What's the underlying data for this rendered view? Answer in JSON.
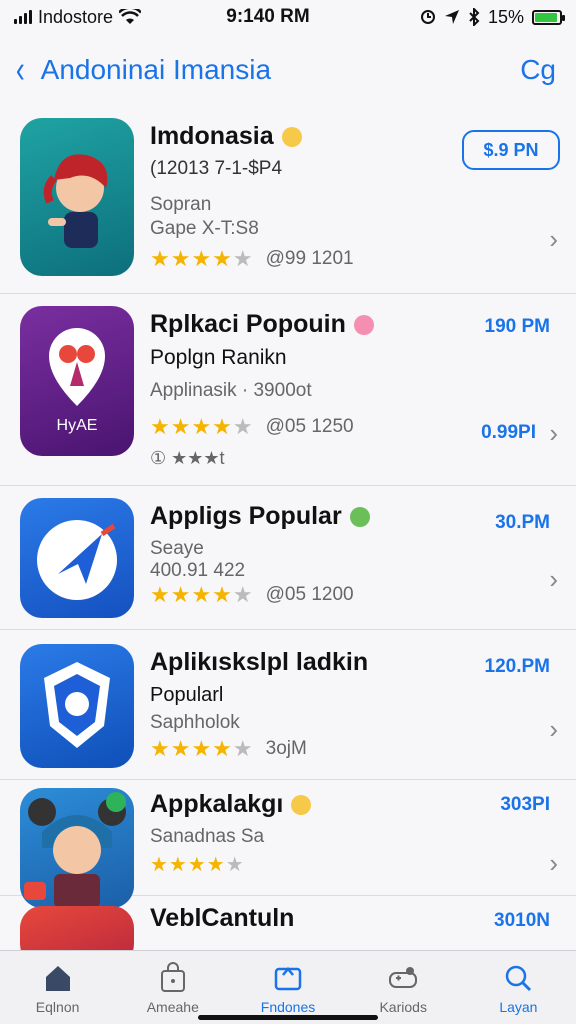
{
  "status_bar": {
    "carrier": "Indostore",
    "time": "9:140 RM",
    "battery_text": "15%"
  },
  "nav": {
    "back_label": "‹",
    "title": "Andoninai Imansia",
    "action": "Cg"
  },
  "apps": [
    {
      "name": "Imdonasia",
      "lines": [
        "(12013 7-1-$P4",
        "Sopran",
        "Gape X-T:S8"
      ],
      "stars": 4,
      "rating_text": "@99 1201",
      "price": "$.9 PN",
      "price_style": "pill",
      "emoji_color": "#f7c948"
    },
    {
      "name": "Rplkaci Popouin",
      "lines": [
        "Poplgn Ranikn",
        "Applinasik · 3900ot"
      ],
      "stars": 4,
      "rating_text": "@05 1250",
      "extra_rating": "① ★★★t",
      "price": "190 PM",
      "price2": "0.99PI",
      "emoji_color": "#f48fb1"
    },
    {
      "name": "Appligs Popular",
      "lines": [
        "Seaye",
        "400.91 422"
      ],
      "stars": 4,
      "rating_text": "@05 1200",
      "price": "30.PM",
      "emoji_color": "#6bbf59"
    },
    {
      "name": "Aplikıskslpl ladkin",
      "lines": [
        "Popularl",
        "Saphholok"
      ],
      "stars": 4,
      "rating_text": "3ojM",
      "price": "120.PM",
      "emoji_color": ""
    },
    {
      "name": "Appkalakgı",
      "lines": [
        "Sanadnas Sa"
      ],
      "stars": 4,
      "rating_text": "",
      "price": "303PI",
      "emoji_color": "#f7c948"
    },
    {
      "name": "VeblCantuln",
      "lines": [],
      "stars": 0,
      "rating_text": "",
      "price": "3010N",
      "emoji_color": ""
    }
  ],
  "tabs": [
    {
      "label": "Eqlnon",
      "icon": "home-icon",
      "active": false
    },
    {
      "label": "Ameahe",
      "icon": "bag-icon",
      "active": false
    },
    {
      "label": "Fndones",
      "icon": "apps-icon",
      "active": true
    },
    {
      "label": "Kariods",
      "icon": "controller-icon",
      "active": false
    },
    {
      "label": "Layan",
      "icon": "search-icon",
      "active": false
    }
  ],
  "colors": {
    "accent": "#1a73e8",
    "star": "#f4b400",
    "battery": "#33c740"
  }
}
